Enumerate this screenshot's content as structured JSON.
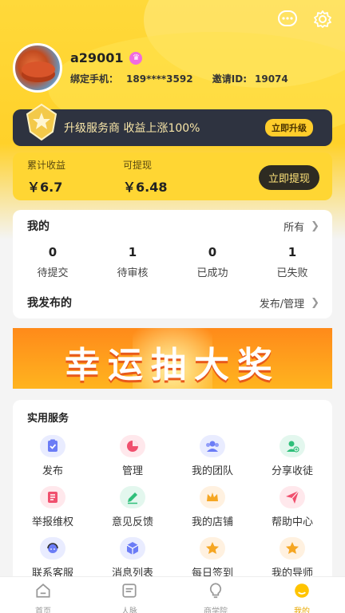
{
  "header": {
    "more_icon": "more-dots-icon",
    "settings_icon": "gear-icon"
  },
  "profile": {
    "username": "a29001",
    "phone_label": "绑定手机：",
    "phone": "189****3592",
    "invite_label": "邀请ID:",
    "invite_id": "19074"
  },
  "vip": {
    "text": "升级服务商 收益上涨100%",
    "button": "立即升级"
  },
  "earnings": {
    "total_label": "累计收益",
    "total_value": "￥6.7",
    "available_label": "可提现",
    "available_value": "￥6.48",
    "withdraw_button": "立即提现"
  },
  "mine": {
    "title": "我的",
    "all_link": "所有",
    "stats": [
      {
        "count": "0",
        "label": "待提交"
      },
      {
        "count": "1",
        "label": "待审核"
      },
      {
        "count": "0",
        "label": "已成功"
      },
      {
        "count": "1",
        "label": "已失败"
      }
    ],
    "published_title": "我发布的",
    "published_link": "发布/管理"
  },
  "banner": {
    "text": "幸运抽大奖"
  },
  "services": {
    "title": "实用服务",
    "items": [
      {
        "label": "发布",
        "icon": "clipboard-check-icon",
        "bg": "#e9ecff",
        "fg": "#6b7cf6"
      },
      {
        "label": "管理",
        "icon": "pie-chart-icon",
        "bg": "#ffe8ec",
        "fg": "#f0506e"
      },
      {
        "label": "我的团队",
        "icon": "team-icon",
        "bg": "#e9ecff",
        "fg": "#6b7cf6"
      },
      {
        "label": "分享收徒",
        "icon": "add-user-icon",
        "bg": "#e3f7ee",
        "fg": "#2fbf7a"
      },
      {
        "label": "举报维权",
        "icon": "report-icon",
        "bg": "#ffe8ec",
        "fg": "#f0506e"
      },
      {
        "label": "意见反馈",
        "icon": "edit-icon",
        "bg": "#e3f7ee",
        "fg": "#2fbf7a"
      },
      {
        "label": "我的店铺",
        "icon": "crown-icon",
        "bg": "#fff1e0",
        "fg": "#f5a623"
      },
      {
        "label": "帮助中心",
        "icon": "paper-plane-icon",
        "bg": "#ffe8ec",
        "fg": "#f0506e"
      },
      {
        "label": "联系客服",
        "icon": "customer-service-icon",
        "bg": "#e9ecff",
        "fg": "#6b7cf6"
      },
      {
        "label": "消息列表",
        "icon": "cube-icon",
        "bg": "#e9ecff",
        "fg": "#6b7cf6"
      },
      {
        "label": "每日签到",
        "icon": "star-icon",
        "bg": "#fff1e0",
        "fg": "#f5a623"
      },
      {
        "label": "我的导师",
        "icon": "star-icon",
        "bg": "#fff1e0",
        "fg": "#f5a623"
      }
    ]
  },
  "tabbar": [
    {
      "label": "首页",
      "icon": "home-icon"
    },
    {
      "label": "人脉",
      "icon": "contacts-icon"
    },
    {
      "label": "商学院",
      "icon": "lightbulb-icon"
    },
    {
      "label": "我的",
      "icon": "user-icon",
      "active": true
    }
  ],
  "colors": {
    "accent": "#ffd633",
    "dark": "#2e3340"
  }
}
